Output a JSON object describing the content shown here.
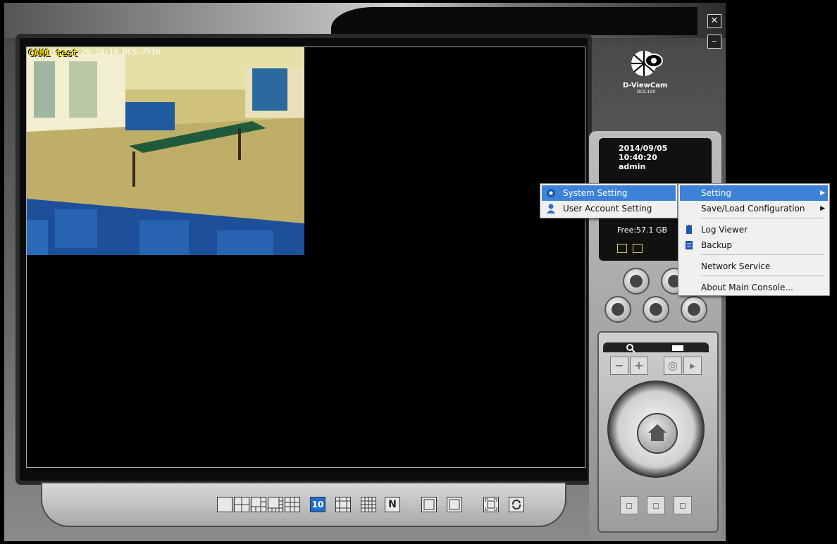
{
  "window": {
    "close_icon": "close-icon",
    "minimize_icon": "minimize-icon"
  },
  "camera": {
    "label": "CAM1 test",
    "osd_text": "2000/01/10 20:28:10 DCS-7510"
  },
  "logo": {
    "brand": "D-ViewCam",
    "model": "DCS-100"
  },
  "status": {
    "date": "2014/09/05",
    "time": "10:40:20",
    "user": "admin",
    "free_space": "Free:57.1 GB"
  },
  "layout_buttons": [
    "1",
    "4",
    "6",
    "8",
    "10",
    "13",
    "16",
    "N"
  ],
  "selected_layout": "10",
  "context_menu": {
    "items": [
      {
        "label": "System Setting",
        "icon": "gear-icon",
        "highlighted": true
      },
      {
        "label": "User Account Setting",
        "icon": "user-icon",
        "highlighted": false
      }
    ]
  },
  "submenu": {
    "items": [
      {
        "label": "Setting",
        "has_submenu": true,
        "highlighted": true
      },
      {
        "label": "Save/Load Configuration",
        "has_submenu": true,
        "highlighted": false
      },
      {
        "label": "Log Viewer",
        "icon": "log-icon",
        "highlighted": false
      },
      {
        "label": "Backup",
        "icon": "backup-icon",
        "highlighted": false
      },
      {
        "label": "Network Service",
        "highlighted": false
      },
      {
        "label": "About Main Console...",
        "highlighted": false
      }
    ]
  },
  "colors": {
    "highlight": "#3d82d8",
    "camera_label": "#ffe600"
  }
}
